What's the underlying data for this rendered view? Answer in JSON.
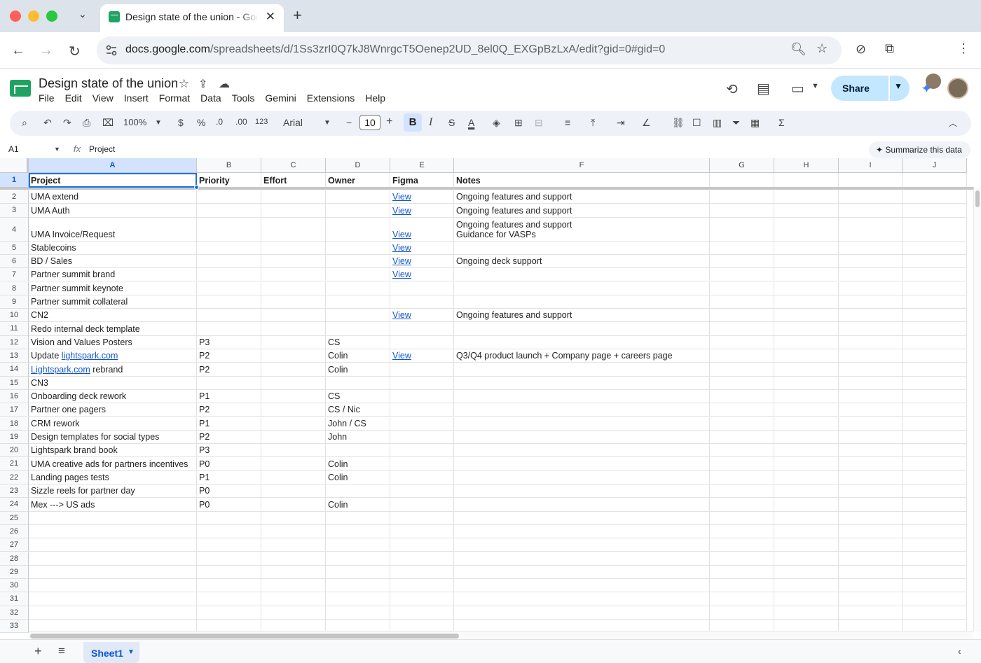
{
  "browser": {
    "tab_title": "Design state of the union - Google Sheets",
    "tab_close": "✕",
    "new_tab": "+",
    "url_host": "docs.google.com",
    "url_path": "/spreadsheets/d/1Ss3zrI0Q7kJ8WnrgcT5Oenep2UD_8el0Q_EXGpBzLxA/edit?gid=0#gid=0"
  },
  "app": {
    "doc_title": "Design state of the union",
    "menu": [
      "File",
      "Edit",
      "View",
      "Insert",
      "Format",
      "Data",
      "Tools",
      "Gemini",
      "Extensions",
      "Help"
    ],
    "share_label": "Share"
  },
  "format_toolbar": {
    "zoom": "100%",
    "currency": "$",
    "percent": "%",
    "dec_decrease": ".0",
    "dec_increase": ".00",
    "number_format": "123",
    "font": "Arial",
    "font_size": "10",
    "bold": "B",
    "italic": "I",
    "strike": "S",
    "text_color": "A",
    "sum": "Σ"
  },
  "formula_bar": {
    "name_box": "A1",
    "fx": "fx",
    "value": "Project",
    "summarize": "Summarize this data"
  },
  "columns": [
    "A",
    "B",
    "C",
    "D",
    "E",
    "F",
    "G",
    "H",
    "I",
    "J"
  ],
  "header_row": [
    "Project",
    "Priority",
    "Effort",
    "Owner",
    "Figma",
    "Notes"
  ],
  "rows": [
    {
      "num": "2",
      "A": "UMA extend",
      "B": "",
      "D": "",
      "E": "View",
      "F": "Ongoing features and support"
    },
    {
      "num": "3",
      "A": "UMA Auth",
      "B": "",
      "D": "",
      "E": "View",
      "F": "Ongoing features and support"
    },
    {
      "num": "4",
      "A": "UMA Invoice/Request",
      "B": "",
      "D": "",
      "E": "View",
      "F": "Ongoing features and support\nGuidance for VASPs"
    },
    {
      "num": "5",
      "A": "Stablecoins",
      "B": "",
      "D": "",
      "E": "View",
      "F": ""
    },
    {
      "num": "6",
      "A": "BD / Sales",
      "B": "",
      "D": "",
      "E": "View",
      "F": "Ongoing deck support"
    },
    {
      "num": "7",
      "A": "Partner summit brand",
      "B": "",
      "D": "",
      "E": "View",
      "F": ""
    },
    {
      "num": "8",
      "A": "Partner summit keynote",
      "B": "",
      "D": "",
      "E": "",
      "F": ""
    },
    {
      "num": "9",
      "A": "Partner summit collateral",
      "B": "",
      "D": "",
      "E": "",
      "F": ""
    },
    {
      "num": "10",
      "A": "CN2",
      "B": "",
      "D": "",
      "E": "View",
      "F": "Ongoing features and support"
    },
    {
      "num": "11",
      "A": "Redo internal deck template",
      "B": "",
      "D": "",
      "E": "",
      "F": ""
    },
    {
      "num": "12",
      "A": "Vision and Values Posters",
      "B": "P3",
      "D": "CS",
      "E": "",
      "F": ""
    },
    {
      "num": "13",
      "A_pre": "Update ",
      "A_link": "lightspark.com",
      "A_post": "",
      "B": "P2",
      "D": "Colin",
      "E": "View",
      "F": "Q3/Q4 product launch + Company page + careers page"
    },
    {
      "num": "14",
      "A_pre": "",
      "A_link": "Lightspark.com",
      "A_post": " rebrand",
      "B": "P2",
      "D": "Colin",
      "E": "",
      "F": ""
    },
    {
      "num": "15",
      "A": "CN3",
      "B": "",
      "D": "",
      "E": "",
      "F": ""
    },
    {
      "num": "16",
      "A": "Onboarding deck rework",
      "B": "P1",
      "D": "CS",
      "E": "",
      "F": ""
    },
    {
      "num": "17",
      "A": "Partner one pagers",
      "B": "P2",
      "D": "CS / Nic",
      "E": "",
      "F": ""
    },
    {
      "num": "18",
      "A": "CRM rework",
      "B": "P1",
      "D": "John / CS",
      "E": "",
      "F": ""
    },
    {
      "num": "19",
      "A": "Design templates for social types",
      "B": "P2",
      "D": "John",
      "E": "",
      "F": ""
    },
    {
      "num": "20",
      "A": "Lightspark brand book",
      "B": "P3",
      "D": "",
      "E": "",
      "F": ""
    },
    {
      "num": "21",
      "A": "UMA creative ads for partners incentives",
      "B": "P0",
      "D": "Colin",
      "E": "",
      "F": ""
    },
    {
      "num": "22",
      "A": "Landing pages tests",
      "B": "P1",
      "D": "Colin",
      "E": "",
      "F": ""
    },
    {
      "num": "23",
      "A": "Sizzle reels for partner day",
      "B": "P0",
      "D": "",
      "E": "",
      "F": ""
    },
    {
      "num": "24",
      "A": "Mex ---> US ads",
      "B": "P0",
      "D": "Colin",
      "E": "",
      "F": ""
    }
  ],
  "empty_rows": [
    "25",
    "26",
    "27",
    "28",
    "29",
    "30",
    "31",
    "32",
    "33"
  ],
  "sheet_tab": "Sheet1",
  "colors": {
    "accent": "#1a73e8",
    "share_bg": "#c2e7ff",
    "link": "#1155cc",
    "sheets_green": "#1ea362"
  }
}
